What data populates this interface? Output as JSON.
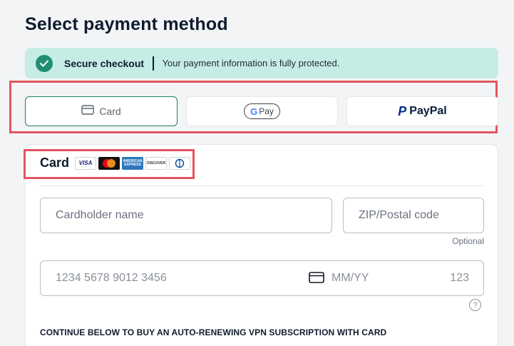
{
  "page": {
    "title": "Select payment method"
  },
  "secure": {
    "label": "Secure checkout",
    "info": "Your payment information is fully protected."
  },
  "methods": {
    "card_label": "Card",
    "gpay_label": "Pay",
    "paypal_label": "PayPal"
  },
  "card_section": {
    "heading": "Card",
    "brands": [
      "VISA",
      "Mastercard",
      "American Express",
      "DISCOVER",
      "Diners Club"
    ],
    "brand_text": {
      "visa": "VISA",
      "amex": "AMERICAN EXPRESS",
      "discover": "DISCOVER"
    }
  },
  "form": {
    "cardholder_placeholder": "Cardholder name",
    "zip_placeholder": "ZIP/Postal code",
    "zip_hint": "Optional",
    "card_number_placeholder": "1234 5678 9012 3456",
    "expiry_placeholder": "MM/YY",
    "cvc_placeholder": "123",
    "help_symbol": "?"
  },
  "notice": "CONTINUE BELOW TO BUY AN AUTO-RENEWING VPN SUBSCRIPTION WITH CARD",
  "colors": {
    "accent": "#1f8f74",
    "banner": "#c6ece6",
    "highlight": "#e1565f"
  }
}
